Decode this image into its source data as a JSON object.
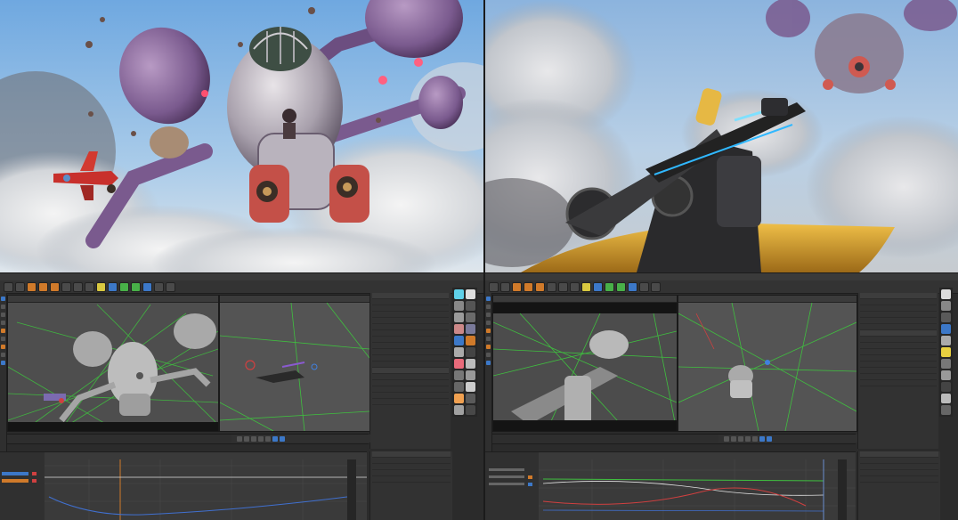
{
  "scenes": {
    "top_left": {
      "description_icon": "airship-render"
    },
    "top_right": {
      "description_icon": "cockpit-gun-render"
    }
  },
  "ui": {
    "accent_orange": "#d07a2a",
    "accent_blue": "#3c78c8",
    "accent_green": "#48b048",
    "wireframe_green": "#3fbf3f",
    "bg_dark": "#2b2b2b"
  },
  "icons": {
    "toolbar": "toolbar-icons",
    "material": "material-swatch-icon",
    "play": "play-icon",
    "keyframe": "keyframe-icon"
  }
}
